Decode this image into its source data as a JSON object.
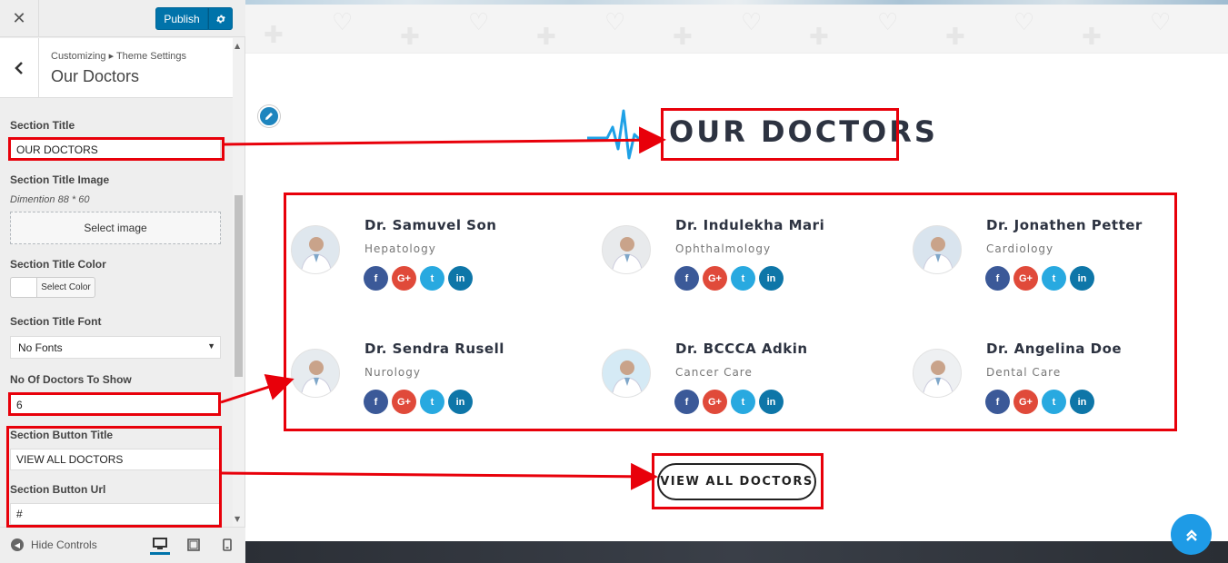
{
  "header": {
    "close_label": "✕",
    "publish_label": "Publish"
  },
  "section_head": {
    "breadcrumb": "Customizing ▸ Theme Settings",
    "title": "Our Doctors"
  },
  "controls": {
    "section_title_label": "Section Title",
    "section_title_value": "OUR DOCTORS",
    "title_image_label": "Section Title Image",
    "title_image_desc": "Dimention 88 * 60",
    "select_image_label": "Select image",
    "title_color_label": "Section Title Color",
    "select_color_label": "Select Color",
    "title_font_label": "Section Title Font",
    "title_font_value": "No Fonts",
    "doctors_count_label": "No Of Doctors To Show",
    "doctors_count_value": "6",
    "button_title_label": "Section Button Title",
    "button_title_value": "VIEW ALL DOCTORS",
    "button_url_label": "Section Button Url",
    "button_url_value": "#"
  },
  "footer": {
    "hide_controls_label": "Hide Controls"
  },
  "preview": {
    "heading": "OUR DOCTORS",
    "button_label": "VIEW ALL DOCTORS",
    "doctors": [
      {
        "name": "Dr. Samuvel Son",
        "specialty": "Hepatology"
      },
      {
        "name": "Dr. Indulekha Mari",
        "specialty": "Ophthalmology"
      },
      {
        "name": "Dr. Jonathen Petter",
        "specialty": "Cardiology"
      },
      {
        "name": "Dr. Sendra Rusell",
        "specialty": "Nurology"
      },
      {
        "name": "Dr. BCCCA Adkin",
        "specialty": "Cancer Care"
      },
      {
        "name": "Dr. Angelina Doe",
        "specialty": "Dental Care"
      }
    ],
    "social": {
      "facebook": "f",
      "google_plus": "G+",
      "twitter": "t",
      "linkedin": "in"
    }
  },
  "colors": {
    "accent": "#0073aa",
    "annotation": "#e8000a",
    "heading": "#2d3341",
    "pulse": "#1ea1e6"
  }
}
